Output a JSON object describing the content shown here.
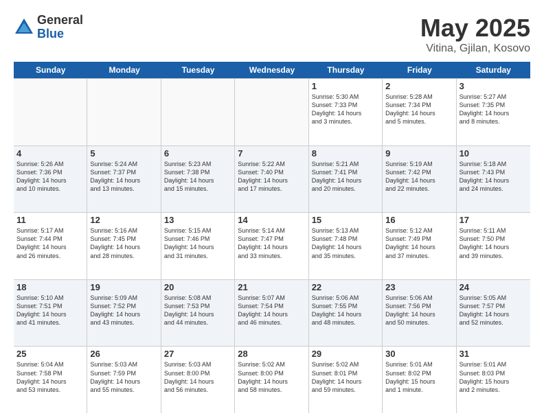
{
  "logo": {
    "general": "General",
    "blue": "Blue"
  },
  "title": {
    "month": "May 2025",
    "location": "Vitina, Gjilan, Kosovo"
  },
  "header_days": [
    "Sunday",
    "Monday",
    "Tuesday",
    "Wednesday",
    "Thursday",
    "Friday",
    "Saturday"
  ],
  "weeks": [
    [
      {
        "day": "",
        "text": "",
        "empty": true
      },
      {
        "day": "",
        "text": "",
        "empty": true
      },
      {
        "day": "",
        "text": "",
        "empty": true
      },
      {
        "day": "",
        "text": "",
        "empty": true
      },
      {
        "day": "1",
        "text": "Sunrise: 5:30 AM\nSunset: 7:33 PM\nDaylight: 14 hours\nand 3 minutes.",
        "empty": false
      },
      {
        "day": "2",
        "text": "Sunrise: 5:28 AM\nSunset: 7:34 PM\nDaylight: 14 hours\nand 5 minutes.",
        "empty": false
      },
      {
        "day": "3",
        "text": "Sunrise: 5:27 AM\nSunset: 7:35 PM\nDaylight: 14 hours\nand 8 minutes.",
        "empty": false
      }
    ],
    [
      {
        "day": "4",
        "text": "Sunrise: 5:26 AM\nSunset: 7:36 PM\nDaylight: 14 hours\nand 10 minutes.",
        "empty": false
      },
      {
        "day": "5",
        "text": "Sunrise: 5:24 AM\nSunset: 7:37 PM\nDaylight: 14 hours\nand 13 minutes.",
        "empty": false
      },
      {
        "day": "6",
        "text": "Sunrise: 5:23 AM\nSunset: 7:38 PM\nDaylight: 14 hours\nand 15 minutes.",
        "empty": false
      },
      {
        "day": "7",
        "text": "Sunrise: 5:22 AM\nSunset: 7:40 PM\nDaylight: 14 hours\nand 17 minutes.",
        "empty": false
      },
      {
        "day": "8",
        "text": "Sunrise: 5:21 AM\nSunset: 7:41 PM\nDaylight: 14 hours\nand 20 minutes.",
        "empty": false
      },
      {
        "day": "9",
        "text": "Sunrise: 5:19 AM\nSunset: 7:42 PM\nDaylight: 14 hours\nand 22 minutes.",
        "empty": false
      },
      {
        "day": "10",
        "text": "Sunrise: 5:18 AM\nSunset: 7:43 PM\nDaylight: 14 hours\nand 24 minutes.",
        "empty": false
      }
    ],
    [
      {
        "day": "11",
        "text": "Sunrise: 5:17 AM\nSunset: 7:44 PM\nDaylight: 14 hours\nand 26 minutes.",
        "empty": false
      },
      {
        "day": "12",
        "text": "Sunrise: 5:16 AM\nSunset: 7:45 PM\nDaylight: 14 hours\nand 28 minutes.",
        "empty": false
      },
      {
        "day": "13",
        "text": "Sunrise: 5:15 AM\nSunset: 7:46 PM\nDaylight: 14 hours\nand 31 minutes.",
        "empty": false
      },
      {
        "day": "14",
        "text": "Sunrise: 5:14 AM\nSunset: 7:47 PM\nDaylight: 14 hours\nand 33 minutes.",
        "empty": false
      },
      {
        "day": "15",
        "text": "Sunrise: 5:13 AM\nSunset: 7:48 PM\nDaylight: 14 hours\nand 35 minutes.",
        "empty": false
      },
      {
        "day": "16",
        "text": "Sunrise: 5:12 AM\nSunset: 7:49 PM\nDaylight: 14 hours\nand 37 minutes.",
        "empty": false
      },
      {
        "day": "17",
        "text": "Sunrise: 5:11 AM\nSunset: 7:50 PM\nDaylight: 14 hours\nand 39 minutes.",
        "empty": false
      }
    ],
    [
      {
        "day": "18",
        "text": "Sunrise: 5:10 AM\nSunset: 7:51 PM\nDaylight: 14 hours\nand 41 minutes.",
        "empty": false
      },
      {
        "day": "19",
        "text": "Sunrise: 5:09 AM\nSunset: 7:52 PM\nDaylight: 14 hours\nand 43 minutes.",
        "empty": false
      },
      {
        "day": "20",
        "text": "Sunrise: 5:08 AM\nSunset: 7:53 PM\nDaylight: 14 hours\nand 44 minutes.",
        "empty": false
      },
      {
        "day": "21",
        "text": "Sunrise: 5:07 AM\nSunset: 7:54 PM\nDaylight: 14 hours\nand 46 minutes.",
        "empty": false
      },
      {
        "day": "22",
        "text": "Sunrise: 5:06 AM\nSunset: 7:55 PM\nDaylight: 14 hours\nand 48 minutes.",
        "empty": false
      },
      {
        "day": "23",
        "text": "Sunrise: 5:06 AM\nSunset: 7:56 PM\nDaylight: 14 hours\nand 50 minutes.",
        "empty": false
      },
      {
        "day": "24",
        "text": "Sunrise: 5:05 AM\nSunset: 7:57 PM\nDaylight: 14 hours\nand 52 minutes.",
        "empty": false
      }
    ],
    [
      {
        "day": "25",
        "text": "Sunrise: 5:04 AM\nSunset: 7:58 PM\nDaylight: 14 hours\nand 53 minutes.",
        "empty": false
      },
      {
        "day": "26",
        "text": "Sunrise: 5:03 AM\nSunset: 7:59 PM\nDaylight: 14 hours\nand 55 minutes.",
        "empty": false
      },
      {
        "day": "27",
        "text": "Sunrise: 5:03 AM\nSunset: 8:00 PM\nDaylight: 14 hours\nand 56 minutes.",
        "empty": false
      },
      {
        "day": "28",
        "text": "Sunrise: 5:02 AM\nSunset: 8:00 PM\nDaylight: 14 hours\nand 58 minutes.",
        "empty": false
      },
      {
        "day": "29",
        "text": "Sunrise: 5:02 AM\nSunset: 8:01 PM\nDaylight: 14 hours\nand 59 minutes.",
        "empty": false
      },
      {
        "day": "30",
        "text": "Sunrise: 5:01 AM\nSunset: 8:02 PM\nDaylight: 15 hours\nand 1 minute.",
        "empty": false
      },
      {
        "day": "31",
        "text": "Sunrise: 5:01 AM\nSunset: 8:03 PM\nDaylight: 15 hours\nand 2 minutes.",
        "empty": false
      }
    ]
  ]
}
